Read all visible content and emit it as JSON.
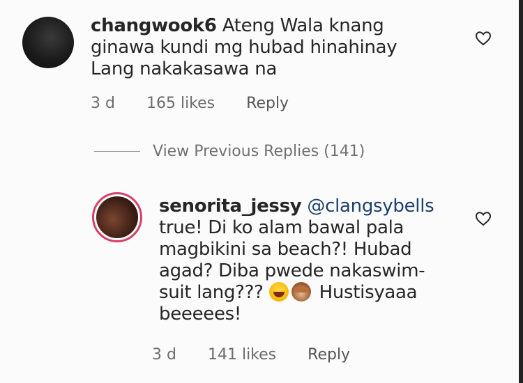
{
  "comments": [
    {
      "username": "changwook6",
      "text": "Ateng Wala knang ginawa kundi mg hubad hinahinay Lang nakakasawa na",
      "time": "3 d",
      "likes": "165 likes",
      "reply_label": "Reply",
      "avatar_icon": "user-avatar-icon",
      "like_icon": "heart-icon"
    },
    {
      "username": "senorita_jessy",
      "mention": "@clangsybells",
      "text_before_emoji": "true! Di ko alam bawal pala magbikini sa beach?! Hubad agad? Diba pwede nakaswim-suit lang???",
      "emojis": [
        "face-with-tears-of-joy-emoji",
        "see-no-evil-monkey-emoji"
      ],
      "text_after_emoji": "Hustisyaaa beeeees!",
      "time": "3 d",
      "likes": "141 likes",
      "reply_label": "Reply",
      "avatar_icon": "user-avatar-icon",
      "like_icon": "heart-icon"
    }
  ],
  "view_previous_replies": "View Previous Replies (141)",
  "colors": {
    "background": "#fbfbfb",
    "text": "#262626",
    "meta_text": "#6b6b6b",
    "mention": "#1d3f6e",
    "story_ring": "#d63f6a"
  }
}
